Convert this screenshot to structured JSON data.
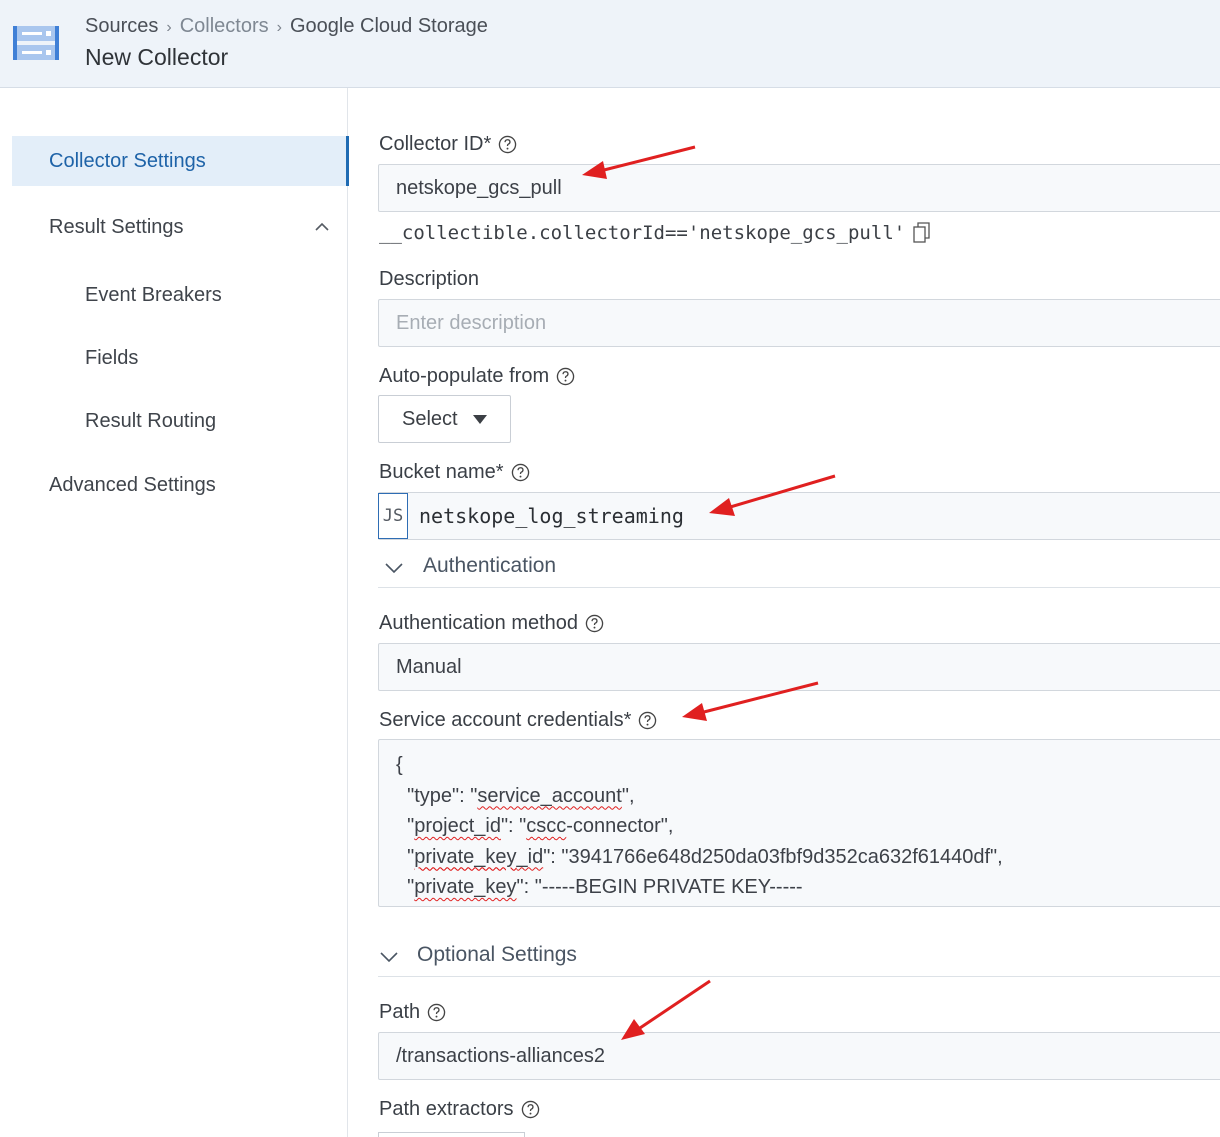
{
  "header": {
    "breadcrumb": [
      "Sources",
      "Collectors",
      "Google Cloud Storage"
    ],
    "title": "New Collector"
  },
  "sidebar": {
    "collector_settings": "Collector Settings",
    "result_settings": "Result Settings",
    "event_breakers": "Event Breakers",
    "fields": "Fields",
    "result_routing": "Result Routing",
    "advanced_settings": "Advanced Settings"
  },
  "form": {
    "collector_id": {
      "label": "Collector ID*",
      "value": "netskope_gcs_pull",
      "expression": "__collectible.collectorId=='netskope_gcs_pull'"
    },
    "description": {
      "label": "Description",
      "placeholder": "Enter description"
    },
    "auto_populate": {
      "label": "Auto-populate from",
      "value": "Select"
    },
    "bucket_name": {
      "label": "Bucket name*",
      "badge": "JS",
      "value": "netskope_log_streaming"
    },
    "authentication": {
      "section_title": "Authentication",
      "method_label": "Authentication method",
      "method_value": "Manual",
      "credentials_label": "Service account credentials*",
      "credentials_lines": [
        "{",
        "  \"type\": \"service_account\",",
        "  \"project_id\": \"cscc-connector\",",
        "  \"private_key_id\": \"3941766e648d250da03fbf9d352ca632f61440df\",",
        "  \"private_key\": \"-----BEGIN PRIVATE KEY-----"
      ]
    },
    "optional": {
      "section_title": "Optional Settings",
      "path_label": "Path",
      "path_value": "/transactions-alliances2",
      "path_extractors_label": "Path extractors"
    }
  },
  "colors": {
    "accent": "#1e63a8",
    "annotation_arrow": "#e02020"
  }
}
